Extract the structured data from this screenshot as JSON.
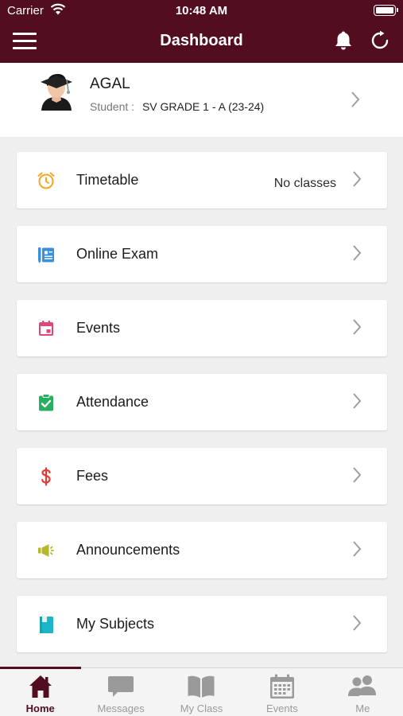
{
  "status_bar": {
    "carrier": "Carrier",
    "time": "10:48 AM"
  },
  "nav": {
    "title": "Dashboard"
  },
  "profile": {
    "name": "AGAL",
    "label": "Student :",
    "class": "SV GRADE 1 - A (23-24)"
  },
  "menu": [
    {
      "label": "Timetable",
      "value": "No classes",
      "icon": "alarm-clock-icon",
      "color": "#f5a623"
    },
    {
      "label": "Online Exam",
      "value": "",
      "icon": "exam-icon",
      "color": "#3a8fd9"
    },
    {
      "label": "Events",
      "value": "",
      "icon": "calendar-icon",
      "color": "#e0457b"
    },
    {
      "label": "Attendance",
      "value": "",
      "icon": "clipboard-check-icon",
      "color": "#27ae60"
    },
    {
      "label": "Fees",
      "value": "",
      "icon": "dollar-icon",
      "color": "#e53935"
    },
    {
      "label": "Announcements",
      "value": "",
      "icon": "megaphone-icon",
      "color": "#b5b82a"
    },
    {
      "label": "My Subjects",
      "value": "",
      "icon": "book-icon",
      "color": "#1fb5c9"
    }
  ],
  "tabs": [
    {
      "label": "Home",
      "icon": "home-icon",
      "active": true
    },
    {
      "label": "Messages",
      "icon": "chat-icon",
      "active": false
    },
    {
      "label": "My Class",
      "icon": "open-book-icon",
      "active": false
    },
    {
      "label": "Events",
      "icon": "calendar-grid-icon",
      "active": false
    },
    {
      "label": "Me",
      "icon": "people-icon",
      "active": false
    }
  ],
  "colors": {
    "brand": "#520d1e",
    "background": "#efeff0",
    "tab_inactive": "#9a9a9a"
  }
}
